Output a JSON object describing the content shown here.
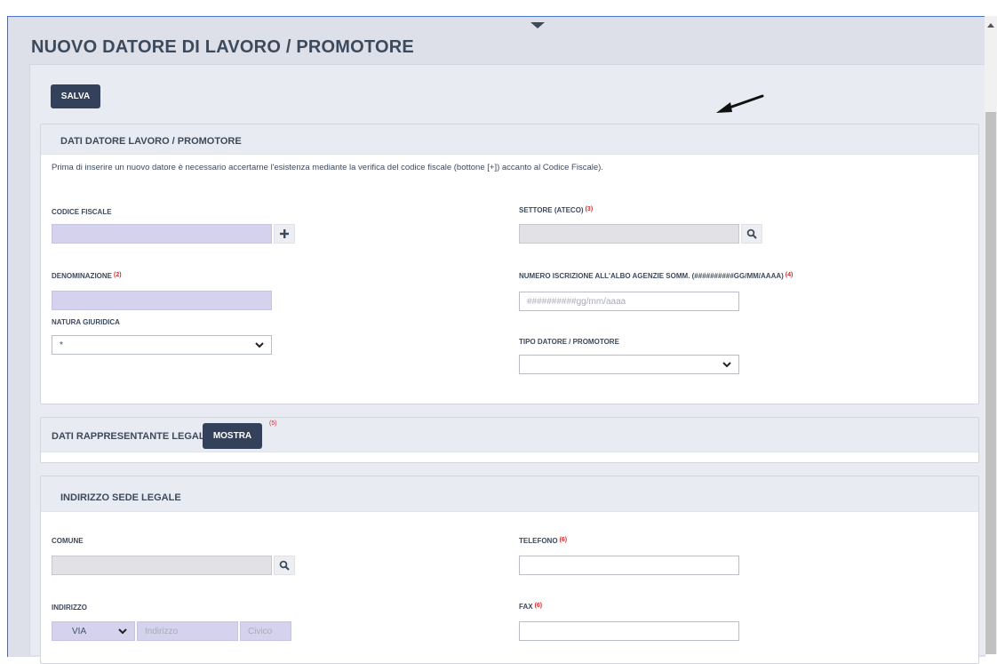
{
  "page": {
    "title": "NUOVO DATORE DI LAVORO / PROMOTORE",
    "save_label": "SALVA"
  },
  "employer_section": {
    "title": "DATI DATORE LAVORO / PROMOTORE",
    "intro": "Prima di inserire un nuovo datore è necessario accertarne l'esistenza mediante la verifica del codice fiscale (bottone [+]) accanto al Codice Fiscale).",
    "codice_fiscale": {
      "label": "CODICE FISCALE",
      "value": ""
    },
    "settore": {
      "label": "SETTORE (ATECO)",
      "note": "(3)",
      "value": ""
    },
    "denominazione": {
      "label": "DENOMINAZIONE",
      "note": "(2)",
      "value": ""
    },
    "numero_iscrizione": {
      "label": "NUMERO ISCRIZIONE ALL'ALBO AGENZIE SOMM. (##########GG/MM/AAAA)",
      "note": "(4)",
      "placeholder": "##########gg/mm/aaaa",
      "value": ""
    },
    "natura_giuridica": {
      "label": "NATURA GIURIDICA",
      "selected": "*"
    },
    "tipo_datore": {
      "label": "TIPO DATORE / PROMOTORE",
      "selected": ""
    }
  },
  "legal_rep_section": {
    "title": "DATI RAPPRESENTANTE LEGALE",
    "show_label": "MOSTRA",
    "note": "(5)"
  },
  "address_section": {
    "title": "INDIRIZZO SEDE LEGALE",
    "comune": {
      "label": "COMUNE",
      "value": ""
    },
    "telefono": {
      "label": "TELEFONO",
      "note": "(6)",
      "value": ""
    },
    "indirizzo": {
      "label": "INDIRIZZO",
      "type_selected": "VIA",
      "address_placeholder": "Indirizzo",
      "civic_placeholder": "Civico"
    },
    "fax": {
      "label": "FAX",
      "note": "(6)",
      "value": ""
    }
  },
  "icons": {
    "add": "plus-icon",
    "search": "magnifier-icon",
    "dropdown": "chevron-down-icon",
    "pointer": "arrow-annotation-icon"
  },
  "colors": {
    "primary_button": "#33425a",
    "heading_text": "#3d4a5c",
    "input_lavender": "#d4d2ec",
    "input_grey": "#e2e2e6",
    "note_red": "#d42b2b",
    "panel_header": "#e8ebf2"
  }
}
